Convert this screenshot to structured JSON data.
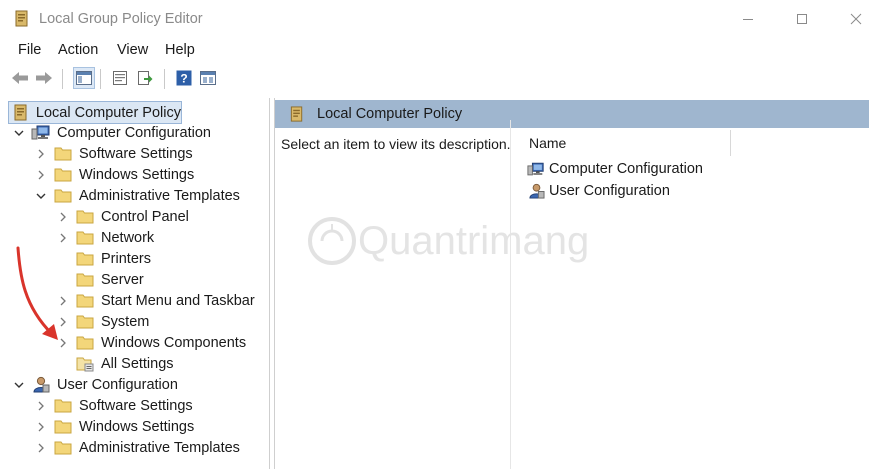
{
  "window": {
    "title": "Local Group Policy Editor",
    "controls": [
      "minimize",
      "maximize",
      "close"
    ]
  },
  "menu": {
    "items": [
      "File",
      "Action",
      "View",
      "Help"
    ]
  },
  "toolbar": {
    "buttons": [
      "back-icon",
      "forward-icon",
      "show-hide-console-tree-icon",
      "properties-icon",
      "export-list-icon",
      "help-icon",
      "extended-view-icon"
    ]
  },
  "tree": {
    "root": "Local Computer Policy",
    "computer_configuration": {
      "label": "Computer Configuration",
      "children": {
        "software_settings": "Software Settings",
        "windows_settings": "Windows Settings",
        "administrative_templates": {
          "label": "Administrative Templates",
          "children": {
            "control_panel": "Control Panel",
            "network": "Network",
            "printers": "Printers",
            "server": "Server",
            "start_menu": "Start Menu and Taskbar",
            "system": "System",
            "windows_components": "Windows Components",
            "all_settings": "All Settings"
          }
        }
      }
    },
    "user_configuration": {
      "label": "User Configuration",
      "children": {
        "software_settings": "Software Settings",
        "windows_settings": "Windows Settings",
        "administrative_templates": "Administrative Templates"
      }
    }
  },
  "right_pane": {
    "header": "Local Computer Policy",
    "description": "Select an item to view its description.",
    "column_name": "Name",
    "items": [
      "Computer Configuration",
      "User Configuration"
    ]
  },
  "colors": {
    "selection": "#dbe7f4",
    "header_bar": "#9fb6cf",
    "folder": "#f3d67a",
    "annotation_arrow": "#d9342b"
  },
  "watermark_text": "Quantrimang"
}
